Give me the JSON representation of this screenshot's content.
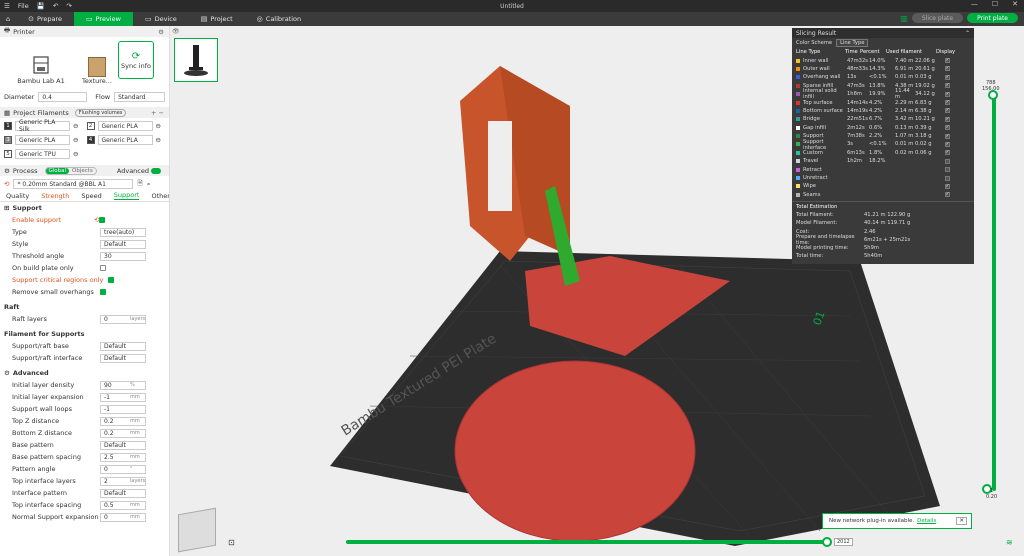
{
  "app": {
    "title": "Untitled",
    "file_menu": "File"
  },
  "tabs": [
    {
      "label": "Prepare"
    },
    {
      "label": "Preview"
    },
    {
      "label": "Device"
    },
    {
      "label": "Project"
    },
    {
      "label": "Calibration"
    }
  ],
  "actions": {
    "slice": "Slice plate",
    "print": "Print plate"
  },
  "printer": {
    "section": "Printer",
    "name": "Bambu Lab A1",
    "plate": "Texture...",
    "sync": "Sync info",
    "diameter_label": "Diameter",
    "diameter": "0.4",
    "flow_label": "Flow",
    "flow": "Standard"
  },
  "filaments": {
    "section": "Project Filaments",
    "badge": "Flushing volumes",
    "items": [
      {
        "num": "1",
        "name": "Generic PLA Silk"
      },
      {
        "num": "2",
        "name": "Generic PLA"
      },
      {
        "num": "3",
        "name": "Generic PLA"
      },
      {
        "num": "4",
        "name": "Generic PLA"
      },
      {
        "num": "5",
        "name": "Generic TPU"
      }
    ]
  },
  "process": {
    "section": "Process",
    "global": "Global",
    "objects": "Objects",
    "advanced": "Advanced",
    "preset": "* 0.20mm Standard @BBL A1",
    "subtabs": [
      "Quality",
      "Strength",
      "Speed",
      "Support",
      "Others"
    ]
  },
  "support": {
    "title": "Support",
    "enable": "Enable support",
    "type_l": "Type",
    "type_v": "tree(auto)",
    "style_l": "Style",
    "style_v": "Default",
    "thr_l": "Threshold angle",
    "thr_v": "30",
    "plate_l": "On build plate only",
    "crit_l": "Support critical regions only",
    "small_l": "Remove small overhangs"
  },
  "raft": {
    "title": "Raft",
    "layers_l": "Raft layers",
    "layers_v": "0",
    "unit": "layers"
  },
  "fil_sup": {
    "title": "Filament for Supports",
    "base_l": "Support/raft base",
    "base_v": "Default",
    "iface_l": "Support/raft interface",
    "iface_v": "Default"
  },
  "advanced": {
    "title": "Advanced",
    "rows": [
      {
        "l": "Initial layer density",
        "v": "90",
        "u": "%"
      },
      {
        "l": "Initial layer expansion",
        "v": "-1",
        "u": "mm"
      },
      {
        "l": "Support wall loops",
        "v": "-1",
        "u": ""
      },
      {
        "l": "Top Z distance",
        "v": "0.2",
        "u": "mm"
      },
      {
        "l": "Bottom Z distance",
        "v": "0.2",
        "u": "mm"
      },
      {
        "l": "Base pattern",
        "v": "Default",
        "u": ""
      },
      {
        "l": "Base pattern spacing",
        "v": "2.5",
        "u": "mm"
      },
      {
        "l": "Pattern angle",
        "v": "0",
        "u": "°"
      },
      {
        "l": "Top interface layers",
        "v": "2",
        "u": "layers"
      },
      {
        "l": "Interface pattern",
        "v": "Default",
        "u": ""
      },
      {
        "l": "Top interface spacing",
        "v": "0.5",
        "u": "mm"
      },
      {
        "l": "Normal Support expansion",
        "v": "0",
        "u": "mm"
      }
    ]
  },
  "slicing": {
    "title": "Slicing Result",
    "scheme_l": "Color Scheme",
    "scheme_v": "Line Type",
    "cols": [
      "Line Type",
      "Time",
      "Percent",
      "Used filament",
      "",
      "Display"
    ],
    "rows": [
      {
        "c": "#f5c518",
        "n": "Inner wall",
        "t": "47m32s",
        "p": "14.0%",
        "m": "7.40 m",
        "g": "22.06 g"
      },
      {
        "c": "#ff8c00",
        "n": "Outer wall",
        "t": "48m33s",
        "p": "14.3%",
        "m": "6.91 m",
        "g": "20.61 g"
      },
      {
        "c": "#3b5bdb",
        "n": "Overhang wall",
        "t": "13s",
        "p": "<0.1%",
        "m": "0.01 m",
        "g": "0.03 g"
      },
      {
        "c": "#b03a2e",
        "n": "Sparse infill",
        "t": "47m3s",
        "p": "13.8%",
        "m": "4.38 m",
        "g": "19.02 g"
      },
      {
        "c": "#9b59b6",
        "n": "Internal solid infill",
        "t": "1h8m",
        "p": "19.9%",
        "m": "11.44 m",
        "g": "34.12 g"
      },
      {
        "c": "#e03131",
        "n": "Top surface",
        "t": "14m14s",
        "p": "4.2%",
        "m": "2.29 m",
        "g": "6.83 g"
      },
      {
        "c": "#1864ab",
        "n": "Bottom surface",
        "t": "14m19s",
        "p": "4.2%",
        "m": "2.14 m",
        "g": "6.38 g"
      },
      {
        "c": "#2f9e9e",
        "n": "Bridge",
        "t": "22m51s",
        "p": "6.7%",
        "m": "3.42 m",
        "g": "10.21 g"
      },
      {
        "c": "#ffffff",
        "n": "Gap infill",
        "t": "2m12s",
        "p": "0.6%",
        "m": "0.13 m",
        "g": "0.39 g"
      },
      {
        "c": "#2b8a3e",
        "n": "Support",
        "t": "7m38s",
        "p": "2.2%",
        "m": "1.07 m",
        "g": "3.18 g"
      },
      {
        "c": "#37b24d",
        "n": "Support interface",
        "t": "3s",
        "p": "<0.1%",
        "m": "0.01 m",
        "g": "0.02 g"
      },
      {
        "c": "#20c997",
        "n": "Custom",
        "t": "6m13s",
        "p": "1.8%",
        "m": "0.02 m",
        "g": "0.06 g"
      },
      {
        "c": "#ced4da",
        "n": "Travel",
        "t": "1h2m",
        "p": "18.2%",
        "m": "",
        "g": ""
      },
      {
        "c": "#cc5de8",
        "n": "Retract",
        "t": "",
        "p": "",
        "m": "",
        "g": ""
      },
      {
        "c": "#4dabf7",
        "n": "Unretract",
        "t": "",
        "p": "",
        "m": "",
        "g": ""
      },
      {
        "c": "#ffe066",
        "n": "Wipe",
        "t": "",
        "p": "",
        "m": "",
        "g": ""
      },
      {
        "c": "#adb5bd",
        "n": "Seams",
        "t": "",
        "p": "",
        "m": "",
        "g": ""
      }
    ],
    "total_title": "Total Estimation",
    "totals": [
      {
        "k": "Total Filament:",
        "v": "41.21 m     122.90 g"
      },
      {
        "k": "Model Filament:",
        "v": "40.14 m     119.71 g"
      },
      {
        "k": "Cost:",
        "v": "2.46"
      },
      {
        "k": "Prepare and timelapse time:",
        "v": "6m21s + 25m21s"
      },
      {
        "k": "Model printing time:",
        "v": "5h9m"
      },
      {
        "k": "Total time:",
        "v": "5h40m"
      }
    ]
  },
  "layers": {
    "top": "788",
    "top2": "156.00",
    "bottom": "1",
    "bottom2": "0.20",
    "hslider": "2012"
  },
  "plate": {
    "label": "Bambu Textured PEI Plate",
    "num": "01"
  },
  "notice": {
    "text": "New network plug-in available.",
    "link": "Details"
  }
}
